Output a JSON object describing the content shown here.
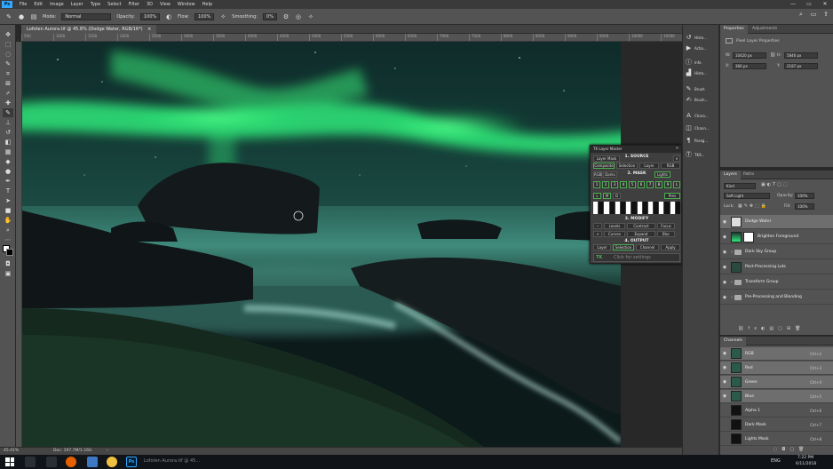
{
  "menu": [
    "File",
    "Edit",
    "Image",
    "Layer",
    "Type",
    "Select",
    "Filter",
    "3D",
    "View",
    "Window",
    "Help"
  ],
  "app_logo": "Ps",
  "window_controls": [
    "—",
    "▭",
    "✕"
  ],
  "options_bar": {
    "mode_label": "Mode:",
    "mode_value": "Normal",
    "opacity_label": "Opacity:",
    "opacity_value": "100%",
    "flow_label": "Flow:",
    "flow_value": "100%",
    "smoothing_label": "Smoothing:",
    "smoothing_value": "0%"
  },
  "document": {
    "tab_title": "Lofoten Aurora.tif @ 45.8% (Dodge Water, RGB/16*)",
    "tab_close": "×",
    "zoom": "45.41%",
    "doc_info": "Doc: 197.7M/1.16G"
  },
  "ruler_ticks": [
    "500",
    "1000",
    "1500",
    "2000",
    "2500",
    "3000",
    "3500",
    "4000",
    "4500",
    "5000",
    "5500",
    "6000",
    "6500",
    "7000",
    "7500",
    "8000",
    "8500",
    "9000",
    "9500",
    "10000",
    "10500"
  ],
  "tools": [
    "move",
    "marquee",
    "lasso",
    "quick-select",
    "crop",
    "frame",
    "eyedropper",
    "healing",
    "brush",
    "stamp",
    "history-brush",
    "eraser",
    "gradient",
    "blur",
    "dodge",
    "pen",
    "type",
    "path-select",
    "rectangle",
    "hand",
    "zoom",
    "more"
  ],
  "icon_strip": [
    {
      "icon": "history",
      "label": "Histo..."
    },
    {
      "icon": "actions",
      "label": "Actio..."
    },
    {
      "icon": "info",
      "label": "Info"
    },
    {
      "icon": "histogram",
      "label": "Histo..."
    },
    {
      "icon": "brush",
      "label": "Brush"
    },
    {
      "icon": "brush-settings",
      "label": "Brush..."
    },
    {
      "icon": "character",
      "label": "Chara..."
    },
    {
      "icon": "channels",
      "label": "Chann..."
    },
    {
      "icon": "paragraph",
      "label": "Parag..."
    },
    {
      "icon": "tk-panel",
      "label": "TK9..."
    }
  ],
  "properties": {
    "tabs": [
      "Properties",
      "Adjustments"
    ],
    "header": "Pixel Layer Properties",
    "w_label": "W:",
    "w_value": "10420 px",
    "h_label": "H:",
    "h_value": "5846 px",
    "x_label": "X:",
    "x_value": "366 px",
    "y_label": "Y:",
    "y_value": "2187 px"
  },
  "layers_panel": {
    "tabs": [
      "Layers",
      "Paths"
    ],
    "kind": "Kind",
    "blend_mode": "Soft Light",
    "opacity_label": "Opacity:",
    "opacity_value": "100%",
    "lock_label": "Lock:",
    "fill_label": "Fill:",
    "fill_value": "100%",
    "layers": [
      {
        "name": "Dodge Water",
        "selected": true,
        "type": "pixel"
      },
      {
        "name": "Brighten Foreground",
        "selected": false,
        "type": "curve"
      },
      {
        "name": "Dark Sky Group",
        "selected": false,
        "type": "group"
      },
      {
        "name": "Post-Processing Luts",
        "selected": false,
        "type": "pixel"
      },
      {
        "name": "Transform Group",
        "selected": false,
        "type": "group"
      },
      {
        "name": "Pre-Processing and Blending",
        "selected": false,
        "type": "group"
      }
    ]
  },
  "channels_panel": {
    "title": "Channels",
    "channels": [
      {
        "name": "RGB",
        "shortcut": "Ctrl+2"
      },
      {
        "name": "Red",
        "shortcut": "Ctrl+3"
      },
      {
        "name": "Green",
        "shortcut": "Ctrl+4"
      },
      {
        "name": "Blue",
        "shortcut": "Ctrl+5"
      },
      {
        "name": "Alpha 1",
        "shortcut": "Ctrl+6"
      },
      {
        "name": "Dark Mask",
        "shortcut": "Ctrl+7"
      },
      {
        "name": "Lights Mask",
        "shortcut": "Ctrl+8"
      }
    ]
  },
  "tk_panel": {
    "title": "TK Layer Master",
    "source_header": "1. SOURCE",
    "layer_mask": "Layer Mask",
    "composite": "Composite",
    "selection": "Selection",
    "layer": "Layer",
    "rgb": "RGB",
    "mask_header": "2. MASK",
    "rgb_tag": "RGB",
    "darks": "Darks",
    "lights": "Lights",
    "zones": [
      "1",
      "2",
      "3",
      "4",
      "5",
      "6",
      "7",
      "8",
      "9",
      "L"
    ],
    "mods": [
      "L",
      "M",
      "D"
    ],
    "preview": "Prev",
    "modify_header": "3. MODIFY",
    "modify_buttons": [
      "Levels",
      "Contract",
      "Focus",
      "Curves",
      "Expand",
      "Blur"
    ],
    "output_header": "4. OUTPUT",
    "output_buttons": [
      "Layer",
      "Selection",
      "Channel",
      "Apply"
    ],
    "footer": "Click for settings"
  },
  "taskbar": {
    "search_placeholder": "Type here to search",
    "active_app": "Lofoten Aurora.tif @ 45...",
    "lang": "ENG",
    "time": "7:22 PM",
    "date": "6/11/2018"
  },
  "colors": {
    "aurora": "#2fe87a",
    "water": "#3f8a7c",
    "accent_green": "#4caf50",
    "ps_blue": "#31a8ff"
  }
}
